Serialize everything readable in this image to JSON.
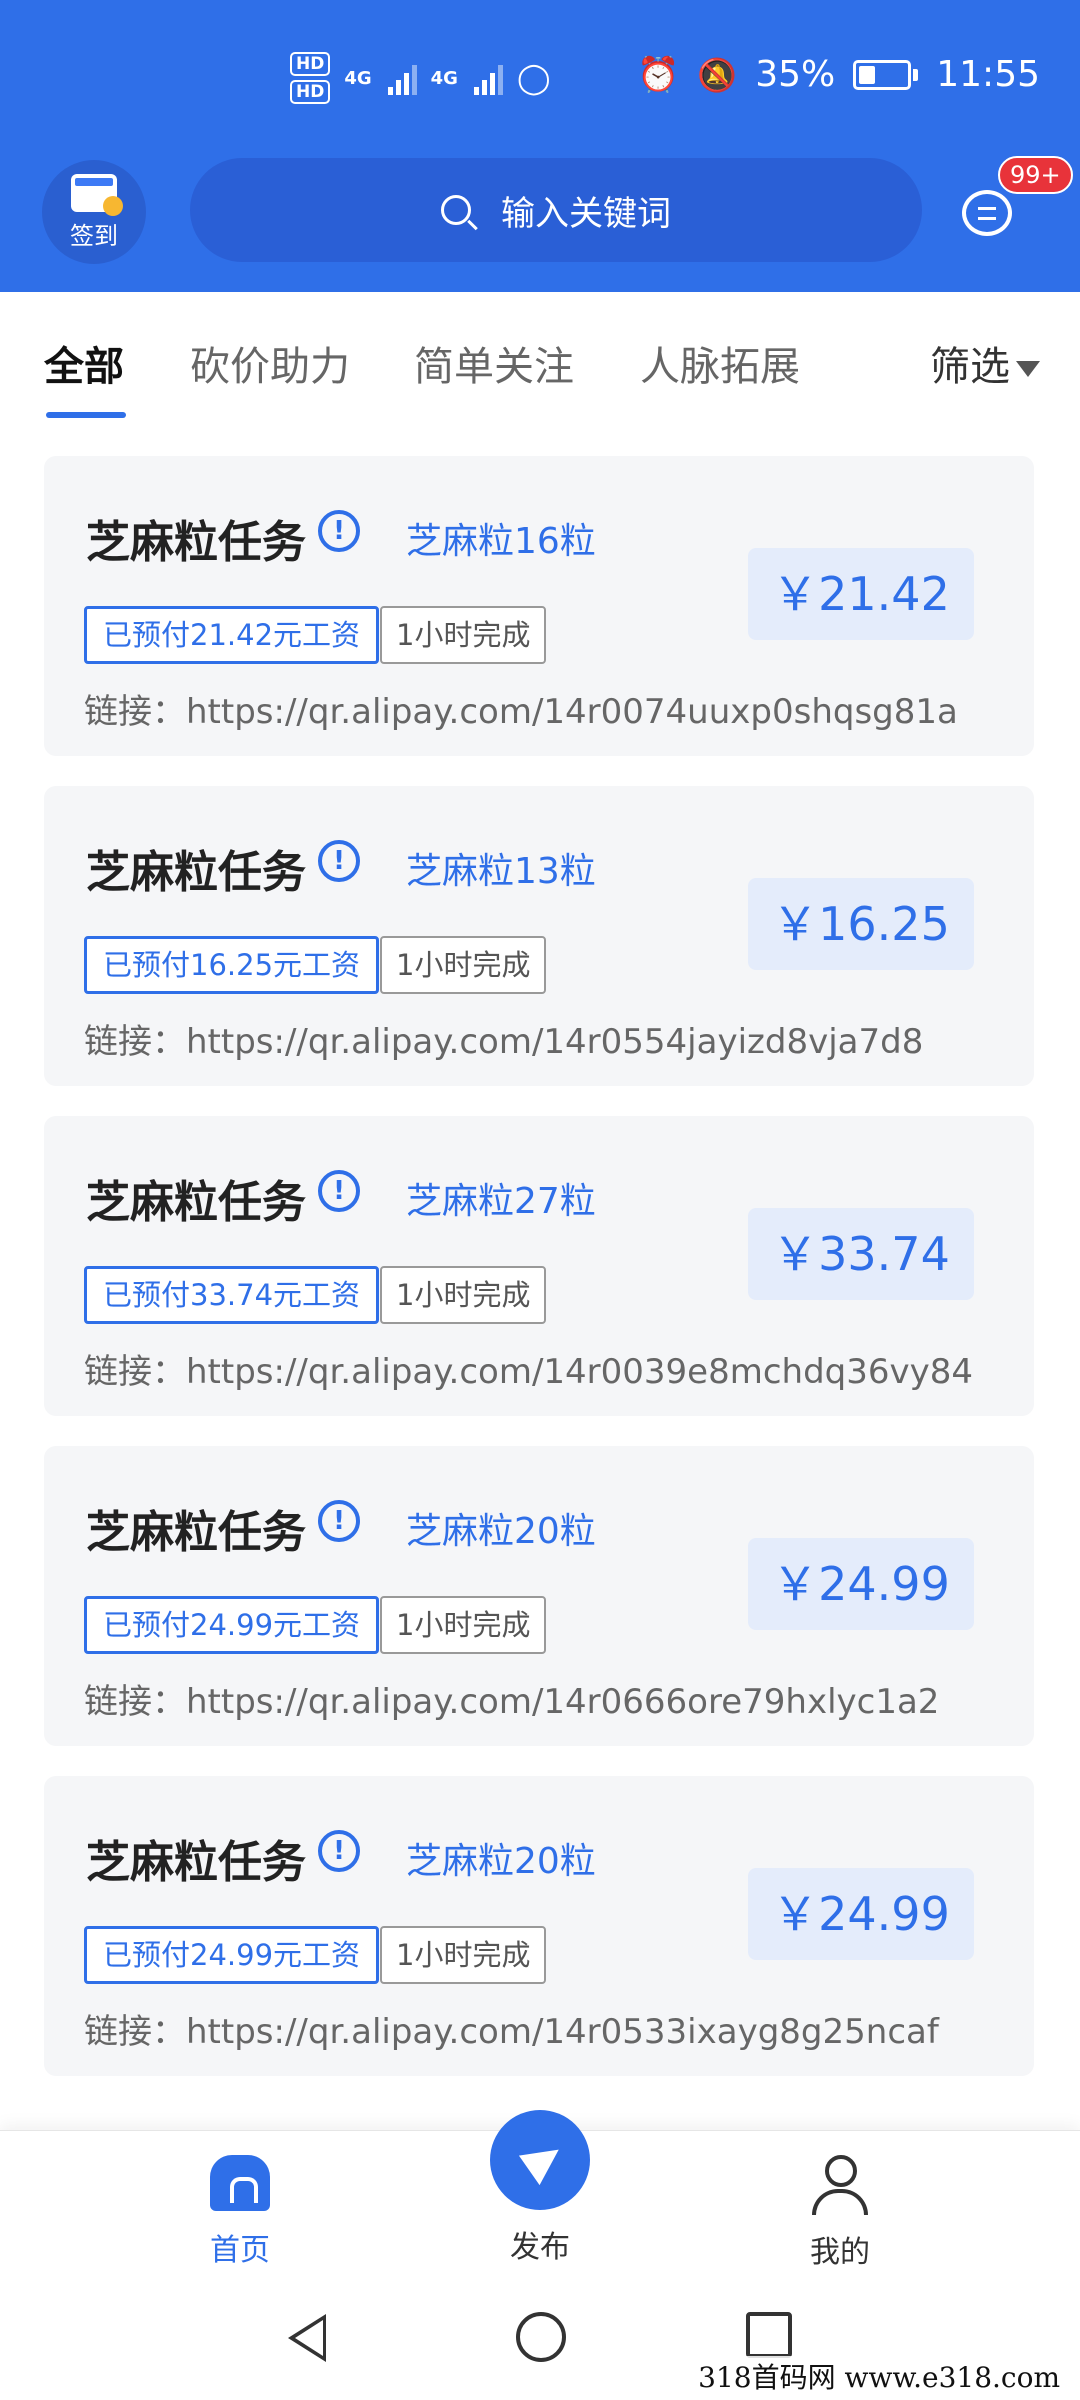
{
  "status_bar": {
    "sim1": "HD",
    "sim2": "HD",
    "network1": "4G",
    "network2": "4G",
    "battery_percent": "35%",
    "battery_level": 0.35,
    "time": "11:55"
  },
  "header": {
    "checkin_label": "签到",
    "search_placeholder": "输入关键词",
    "message_badge": "99+"
  },
  "tabs": {
    "items": [
      "全部",
      "砍价助力",
      "简单关注",
      "人脉拓展"
    ],
    "active_index": 0,
    "filter_label": "筛选"
  },
  "tasks": [
    {
      "title": "芝麻粒任务",
      "grains": "芝麻粒16粒",
      "paid_tag": "已预付21.42元工资",
      "time_tag": "1小时完成",
      "link": "链接：https://qr.alipay.com/14r0074uuxp0shqsg81a",
      "price": "￥21.42"
    },
    {
      "title": "芝麻粒任务",
      "grains": "芝麻粒13粒",
      "paid_tag": "已预付16.25元工资",
      "time_tag": "1小时完成",
      "link": "链接：https://qr.alipay.com/14r0554jayizd8vja7d8",
      "price": "￥16.25"
    },
    {
      "title": "芝麻粒任务",
      "grains": "芝麻粒27粒",
      "paid_tag": "已预付33.74元工资",
      "time_tag": "1小时完成",
      "link": "链接：https://qr.alipay.com/14r0039e8mchdq36vy84",
      "price": "￥33.74"
    },
    {
      "title": "芝麻粒任务",
      "grains": "芝麻粒20粒",
      "paid_tag": "已预付24.99元工资",
      "time_tag": "1小时完成",
      "link": "链接：https://qr.alipay.com/14r0666ore79hxlyc1a2",
      "price": "￥24.99"
    },
    {
      "title": "芝麻粒任务",
      "grains": "芝麻粒20粒",
      "paid_tag": "已预付24.99元工资",
      "time_tag": "1小时完成",
      "link": "链接：https://qr.alipay.com/14r0533ixayg8g25ncaf",
      "price": "￥24.99"
    }
  ],
  "bottom_nav": {
    "home": "首页",
    "publish": "发布",
    "mine": "我的"
  },
  "watermark": "318首码网 www.e318.com",
  "colors": {
    "primary": "#2f6fe8",
    "badge": "#e8333a"
  }
}
